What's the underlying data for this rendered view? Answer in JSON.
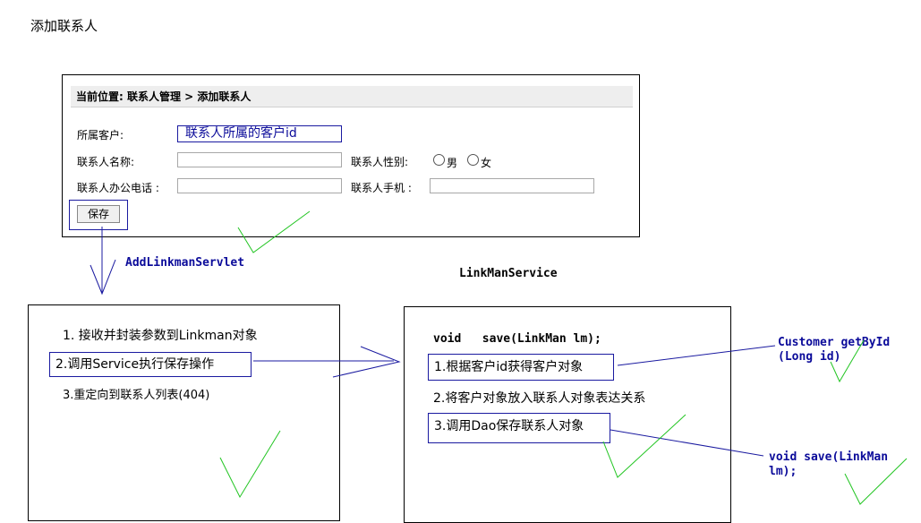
{
  "page_title": "添加联系人",
  "form": {
    "breadcrumb": "当前位置: 联系人管理 > 添加联系人",
    "customer_label": "所属客户:",
    "customer_value": "联系人所属的客户id",
    "name_label": "联系人名称:",
    "gender_label": "联系人性别:",
    "gender_options": [
      "男",
      "女"
    ],
    "office_phone_label": "联系人办公电话 :",
    "mobile_label": "联系人手机 :",
    "save_label": "保存"
  },
  "servlet": {
    "name": "AddLinkmanServlet",
    "steps": [
      "1. 接收并封装参数到Linkman对象",
      "2.调用Service执行保存操作",
      "3.重定向到联系人列表(404)"
    ]
  },
  "service": {
    "name": "LinkManService",
    "method": "void   save(LinkMan lm);",
    "steps": [
      "1.根据客户id获得客户对象",
      "2.将客户对象放入联系人对象表达关系",
      "3.调用Dao保存联系人对象"
    ]
  },
  "notes": {
    "customer_dao": "Customer getById\n(Long id)",
    "linkman_dao": "void   save(LinkMan\nlm);"
  },
  "colors": {
    "annotation_blue": "#1a1aa0",
    "check_green": "#22c522"
  }
}
